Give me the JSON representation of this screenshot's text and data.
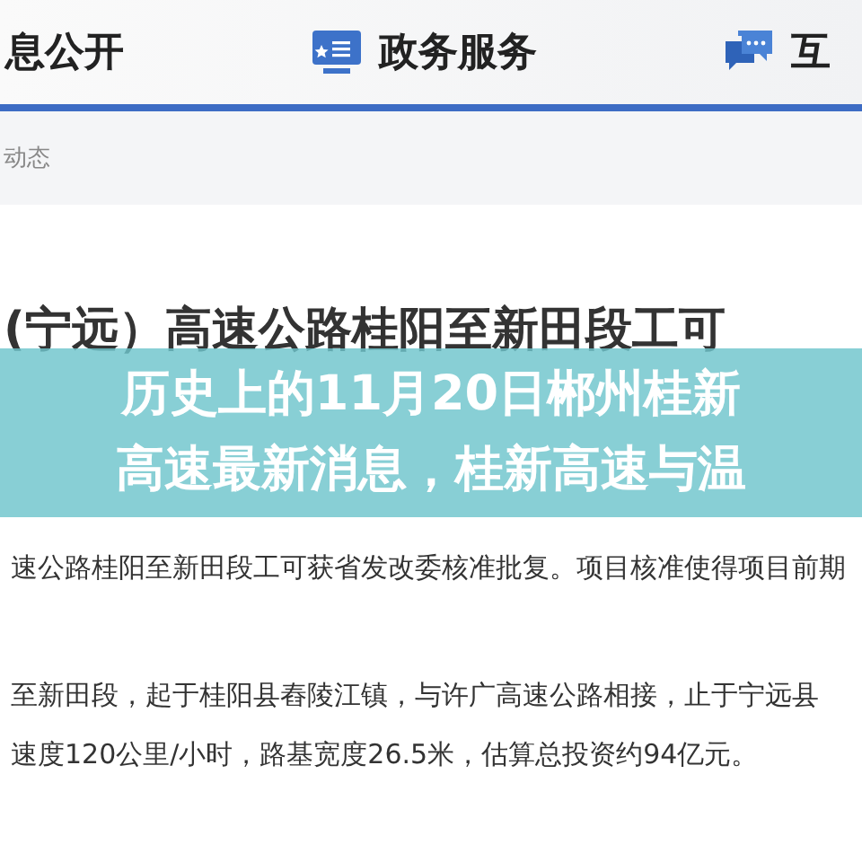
{
  "nav": [
    {
      "label": "息公开"
    },
    {
      "label": "政务服务"
    },
    {
      "label": "互"
    }
  ],
  "breadcrumb": "动态",
  "article": {
    "headline": "(宁远）高速公路桂阳至新田段工可",
    "paragraphs": [
      "速公路桂阳至新田段工可获省发改委核准批复。项目核准使得项目前期",
      "至新田段，起于桂阳县舂陵江镇，与许广高速公路相接，止于宁远县",
      "速度120公里/小时，路基宽度26.5米，估算总投资约94亿元。"
    ]
  },
  "banner": {
    "lines": [
      "历史上的11月20日郴州桂新",
      "高速最新消息，桂新高速与温"
    ]
  }
}
